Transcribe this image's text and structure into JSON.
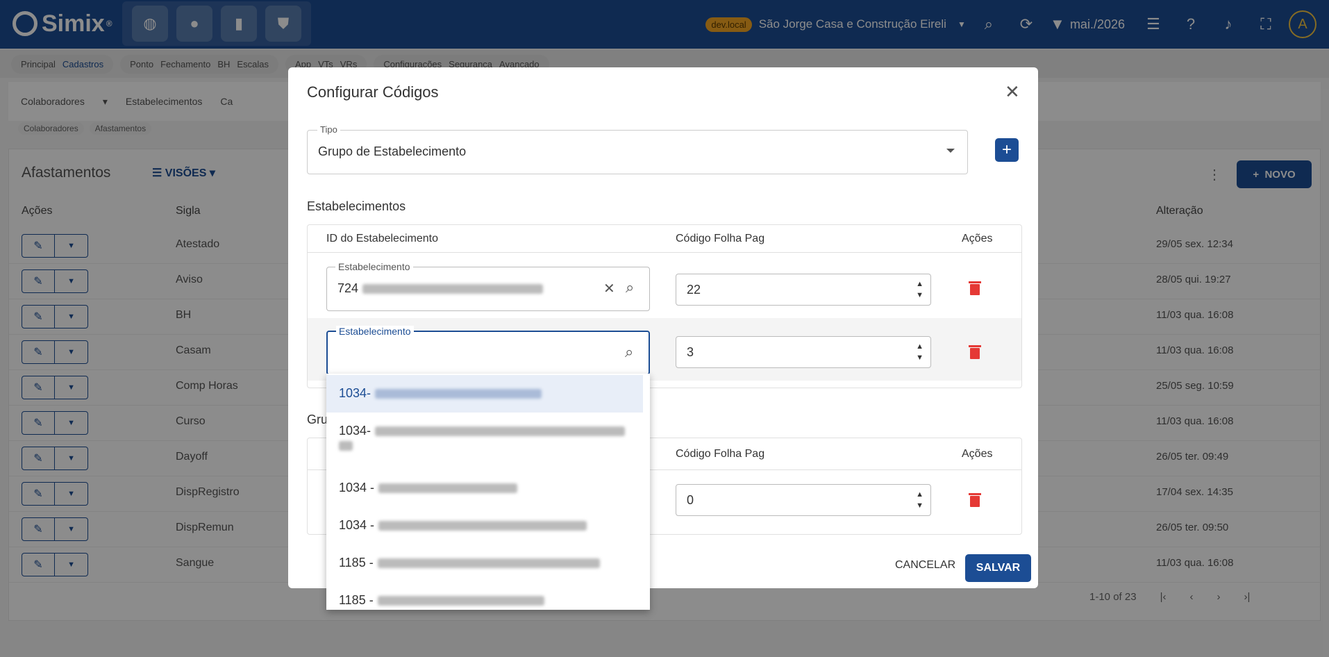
{
  "topbar": {
    "logo_text": "Simix",
    "logo_reg": "®",
    "env_badge": "dev.local",
    "company": "São Jorge Casa e Construção Eireli",
    "period": "mai./2026",
    "avatar": "A"
  },
  "nav": {
    "groups": [
      [
        "Principal",
        "Cadastros"
      ],
      [
        "Ponto",
        "Fechamento",
        "BH",
        "Escalas"
      ],
      [
        "App",
        "VTs",
        "VRs"
      ],
      [
        "Configurações",
        "Segurança",
        "Avançado"
      ]
    ]
  },
  "subnav": {
    "items": [
      "Colaboradores",
      "Estabelecimentos",
      "Ca"
    ]
  },
  "breadcrumb": [
    "Colaboradores",
    "Afastamentos"
  ],
  "list": {
    "title": "Afastamentos",
    "views_label": "VISÕES",
    "new_label": "NOVO",
    "headers": {
      "actions": "Ações",
      "sigla": "Sigla",
      "alteracao": "Alteração"
    },
    "rows": [
      {
        "sigla": "Atestado",
        "alteracao": "29/05 sex. 12:34"
      },
      {
        "sigla": "Aviso",
        "alteracao": "28/05 qui. 19:27"
      },
      {
        "sigla": "BH",
        "alteracao": "11/03 qua. 16:08"
      },
      {
        "sigla": "Casam",
        "alteracao": "11/03 qua. 16:08"
      },
      {
        "sigla": "Comp Horas",
        "alteracao": "25/05 seg. 10:59"
      },
      {
        "sigla": "Curso",
        "alteracao": "11/03 qua. 16:08"
      },
      {
        "sigla": "Dayoff",
        "alteracao": "26/05 ter. 09:49"
      },
      {
        "sigla": "DispRegistro",
        "alteracao": "17/04 sex. 14:35"
      },
      {
        "sigla": "DispRemun",
        "alteracao": "26/05 ter. 09:50"
      },
      {
        "sigla": "Sangue",
        "alteracao": "11/03 qua. 16:08"
      }
    ],
    "pagination": "1-10 of 23"
  },
  "modal": {
    "title": "Configurar Códigos",
    "tipo_label": "Tipo",
    "tipo_value": "Grupo de Estabelecimento",
    "section_estab": "Estabelecimentos",
    "section_group": "Gru",
    "col_id": "ID do Estabelecimento",
    "col_codigo": "Código Folha Pag",
    "col_acoes": "Ações",
    "field_label": "Estabelecimento",
    "rows": [
      {
        "estab": "724",
        "codigo": "22"
      },
      {
        "estab": "",
        "codigo": "3"
      }
    ],
    "group_rows": [
      {
        "codigo": "0"
      }
    ],
    "cancel": "CANCELAR",
    "save": "SALVAR"
  },
  "dropdown": {
    "options": [
      "1034-",
      "1034-",
      "1034 -",
      "1034 -",
      "1185 -",
      "1185 -"
    ]
  },
  "colors": {
    "primary": "#1c4d94",
    "danger": "#e53935",
    "badge": "#f5a623"
  }
}
